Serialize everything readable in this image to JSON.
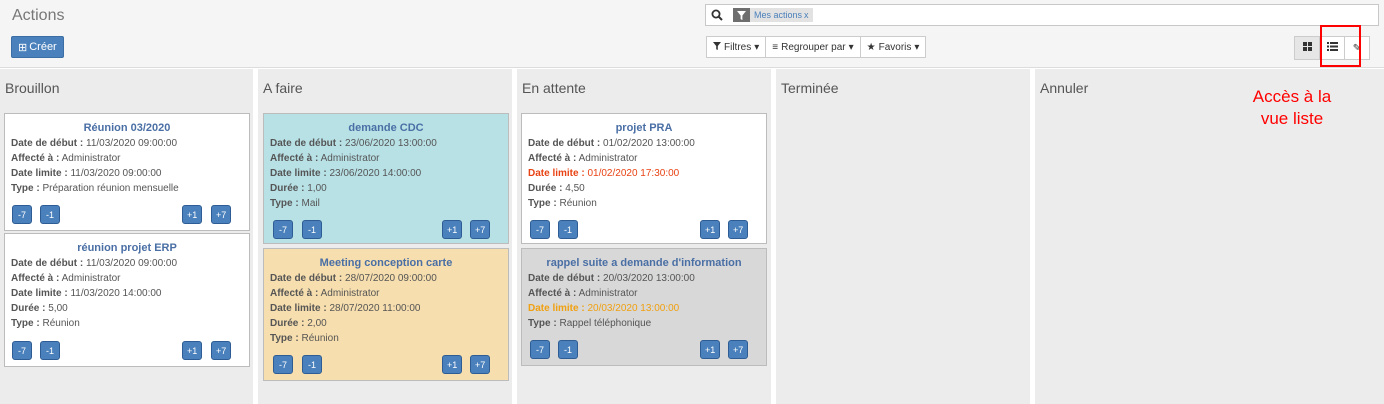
{
  "header": {
    "title": "Actions",
    "create_label": "Créer",
    "create_icon": "plus-square-icon"
  },
  "search": {
    "facet_value": "Mes actions",
    "facet_close": "x"
  },
  "toolbar": {
    "filters_label": "Filtres",
    "groupby_label": "Regrouper par",
    "favorites_label": "Favoris"
  },
  "views": [
    "kanban-view-icon",
    "list-view-icon",
    "activity-view-icon"
  ],
  "annotation": {
    "line1": "Accès à la",
    "line2": "vue liste",
    "color": "#ff0000"
  },
  "labels": {
    "start": "Date de début :",
    "assigned": "Affecté à :",
    "deadline": "Date limite :",
    "duration": "Durée :",
    "type": "Type :"
  },
  "buttons": [
    "-7",
    "-1",
    "+1",
    "+7"
  ],
  "columns": [
    {
      "title": "Brouillon",
      "cards": [
        {
          "title": "Réunion 03/2020",
          "start": "11/03/2020 09:00:00",
          "assigned": "Administrator",
          "deadline": "11/03/2020 09:00:00",
          "type": "Préparation réunion mensuelle"
        },
        {
          "title": "réunion projet ERP",
          "start": "11/03/2020 09:00:00",
          "assigned": "Administrator",
          "deadline": "11/03/2020 14:00:00",
          "duration": "5,00",
          "type": "Réunion"
        }
      ]
    },
    {
      "title": "A faire",
      "cards": [
        {
          "title": "demande CDC",
          "start": "23/06/2020 13:00:00",
          "assigned": "Administrator",
          "deadline": "23/06/2020 14:00:00",
          "duration": "1,00",
          "type": "Mail"
        },
        {
          "title": "Meeting conception carte",
          "start": "28/07/2020 09:00:00",
          "assigned": "Administrator",
          "deadline": "28/07/2020 11:00:00",
          "duration": "2,00",
          "type": "Réunion"
        }
      ]
    },
    {
      "title": "En attente",
      "cards": [
        {
          "title": "projet PRA",
          "start": "01/02/2020 13:00:00",
          "assigned": "Administrator",
          "deadline": "01/02/2020 17:30:00",
          "duration": "4,50",
          "type": "Réunion"
        },
        {
          "title": "rappel suite a demande d'information",
          "start": "20/03/2020 13:00:00",
          "assigned": "Administrator",
          "deadline": "20/03/2020 13:00:00",
          "type": "Rappel téléphonique"
        }
      ]
    },
    {
      "title": "Terminée",
      "cards": []
    },
    {
      "title": "Annuler",
      "cards": []
    }
  ],
  "colors": {
    "primary": "#4a80bb",
    "card_blue": "#b8e1e6",
    "card_orange": "#f6deae",
    "card_grey": "#d8d8d8",
    "deadline_overdue": "#e84315",
    "deadline_today": "#f0a010"
  }
}
